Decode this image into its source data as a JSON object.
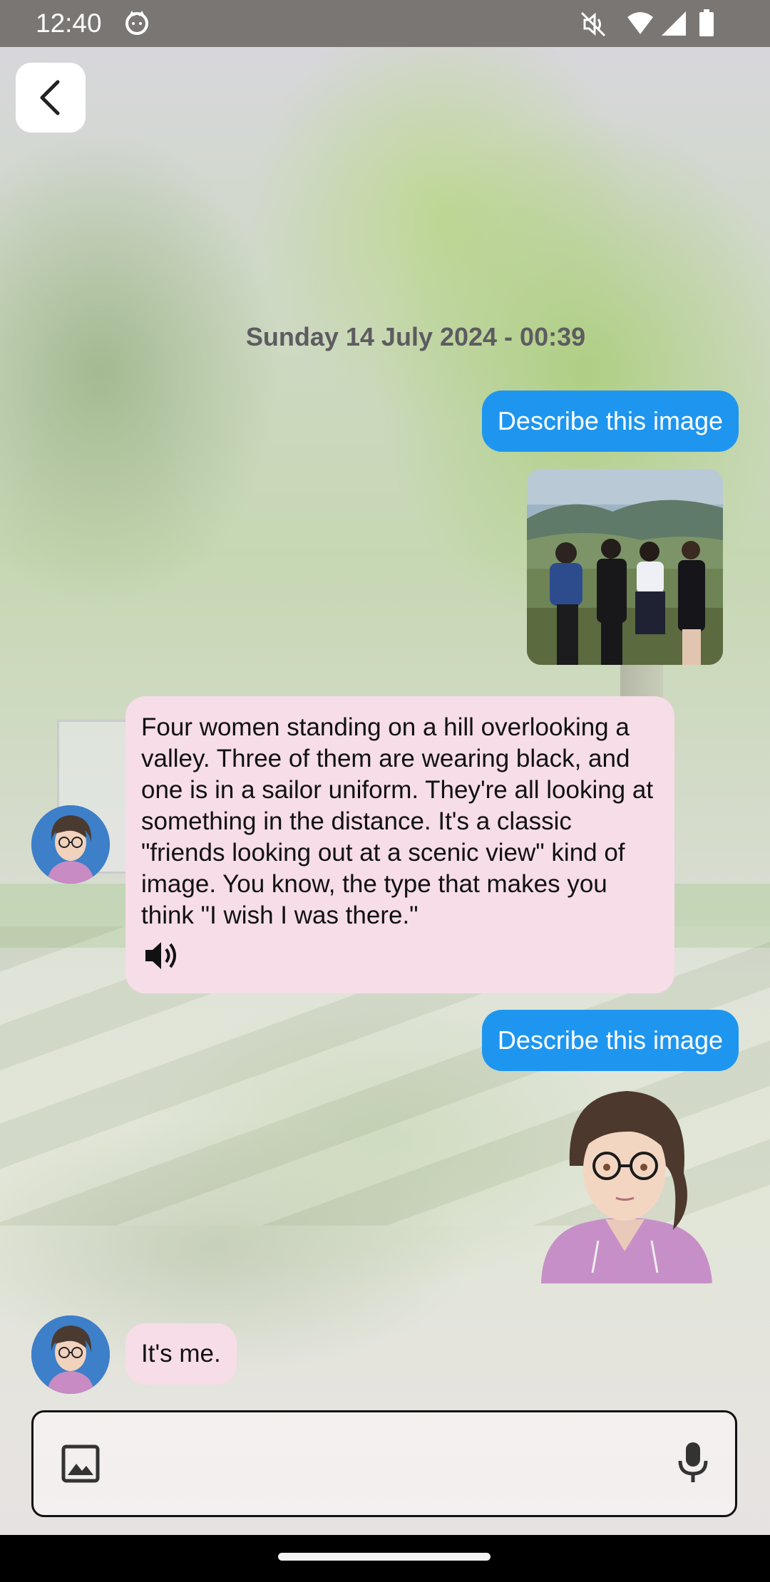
{
  "status_bar": {
    "time": "12:40",
    "icons": [
      "cat-icon",
      "mute-icon",
      "wifi-icon",
      "signal-icon",
      "battery-icon"
    ]
  },
  "header": {
    "back_icon": "chevron-left-icon"
  },
  "chat": {
    "date": "Sunday 14 July 2024 - 00:39",
    "messages": [
      {
        "sender": "user",
        "text": "Describe this image",
        "attachment": "photo of four women on a hill"
      },
      {
        "sender": "bot",
        "text": "Four women standing on a hill overlooking a valley.  Three of them are wearing black, and one is in a sailor uniform. They're all looking at something in the distance. It's a classic \"friends looking out at a scenic view\" kind of image. You know, the type that makes you think \"I wish I was there.\"",
        "speaker_icon": "speaker-icon"
      },
      {
        "sender": "user",
        "text": "Describe this image",
        "attachment": "illustrated character with glasses and pink hoodie"
      },
      {
        "sender": "bot",
        "text": "It's me."
      }
    ]
  },
  "composer": {
    "placeholder": "",
    "value": "",
    "attach_icon": "image-icon",
    "mic_icon": "mic-icon"
  },
  "colors": {
    "user_bubble": "#1e96ef",
    "bot_bubble": "#f6dde8",
    "status_bar": "#7a7674"
  }
}
